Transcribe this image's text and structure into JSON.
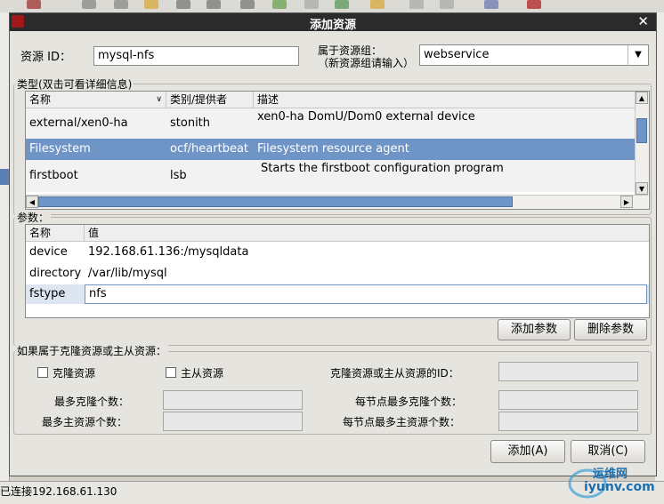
{
  "dialog": {
    "title": "添加资源",
    "close_glyph": "✕"
  },
  "resource_id": {
    "label": "资源 ID：",
    "value": "mysql-nfs"
  },
  "resource_group": {
    "label_line1": "属于资源组：",
    "label_line2": "（新资源组请输入）",
    "value": "webservice"
  },
  "type_section": {
    "legend": "类型(双击可看详细信息)",
    "headers": [
      "名称",
      "类别/提供者",
      "描述"
    ],
    "sort_glyph": "∨",
    "rows": [
      {
        "name": "external/xen0-ha",
        "provider": "stonith",
        "desc": "xen0-ha DomU/Dom0 external device"
      },
      {
        "name": "Filesystem",
        "provider": "ocf/heartbeat",
        "desc": "Filesystem resource agent"
      },
      {
        "name": "firstboot",
        "provider": "lsb",
        "desc": "Starts the firstboot configuration program"
      }
    ]
  },
  "params_section": {
    "legend": "参数：",
    "headers": [
      "名称",
      "值"
    ],
    "rows": [
      {
        "name": "device",
        "value": "192.168.61.136:/mysqldata"
      },
      {
        "name": "directory",
        "value": "/var/lib/mysql"
      },
      {
        "name": "fstype",
        "value": "nfs"
      }
    ],
    "add_label": "添加参数",
    "delete_label": "删除参数"
  },
  "clone_section": {
    "legend": "如果属于克隆资源或主从资源：",
    "clone_checkbox": "克隆资源",
    "master_checkbox": "主从资源",
    "clone_id_label": "克隆资源或主从资源的ID：",
    "max_clones_label": "最多克隆个数：",
    "max_masters_label": "最多主资源个数：",
    "max_clones_per_node_label": "每节点最多克隆个数：",
    "max_masters_per_node_label": "每节点最多主资源个数："
  },
  "buttons": {
    "add": "添加(A)",
    "cancel": "取消(C)"
  },
  "status_bar": {
    "text": "已连接192.168.61.130"
  },
  "watermark": {
    "line1": "运维网",
    "line2": "iyunv.com"
  },
  "colors": {
    "selection": "#6f94c6",
    "titlebar": "#2b2b2b"
  }
}
